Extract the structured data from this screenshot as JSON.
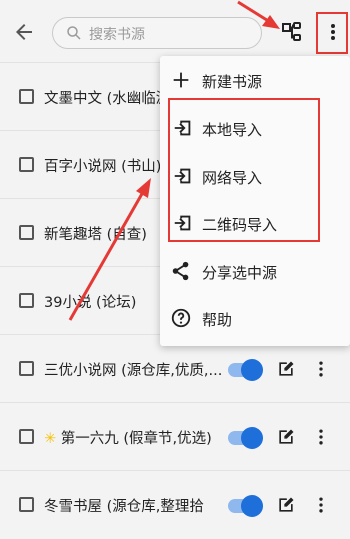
{
  "search": {
    "placeholder": "搜索书源"
  },
  "rows": [
    {
      "label": "文墨中文 (水幽临渊"
    },
    {
      "label": "百字小说网 (书山)"
    },
    {
      "label": "新笔趣塔 (自查)"
    },
    {
      "label": "39小说 (论坛)"
    },
    {
      "label": "三优小说网 (源仓库,优质,..."
    },
    {
      "label": "第一六九 (假章节,优选)"
    },
    {
      "label": "冬雪书屋 (源仓库,整理拾"
    }
  ],
  "menu": {
    "items": [
      {
        "label": "新建书源",
        "icon": "plus-icon"
      },
      {
        "label": "本地导入",
        "icon": "import-icon"
      },
      {
        "label": "网络导入",
        "icon": "import-icon"
      },
      {
        "label": "二维码导入",
        "icon": "import-icon"
      },
      {
        "label": "分享选中源",
        "icon": "share-icon"
      },
      {
        "label": "帮助",
        "icon": "help-icon"
      }
    ]
  },
  "colors": {
    "accent": "#1e6fd9",
    "toggle_track": "#8fb8ef",
    "highlight": "#e53935",
    "background": "#f3f3f3"
  }
}
